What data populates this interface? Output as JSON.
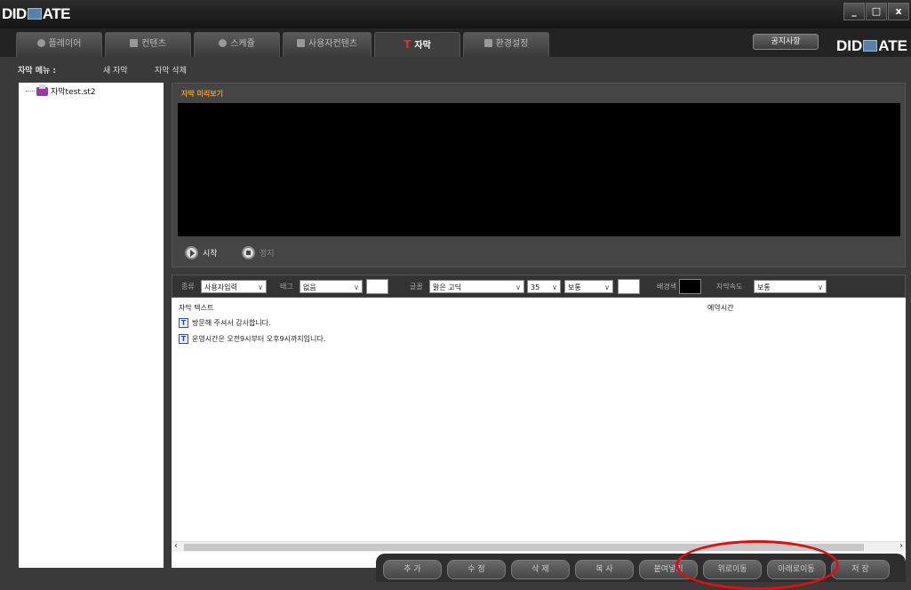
{
  "window": {
    "logo_left": "DID",
    "logo_right": "ATE",
    "controls": [
      "_",
      "□",
      "x"
    ]
  },
  "tabs": [
    {
      "label": "플레이어",
      "icon": "play-circle-icon",
      "active": false
    },
    {
      "label": "컨텐츠",
      "icon": "film-icon",
      "active": false
    },
    {
      "label": "스케쥴",
      "icon": "clock-icon",
      "active": false
    },
    {
      "label": "사용자컨텐츠",
      "icon": "user-content-icon",
      "active": false
    },
    {
      "label": "자막",
      "icon": "subtitle-t-icon",
      "active": true
    },
    {
      "label": "환경설정",
      "icon": "settings-icon",
      "active": false
    }
  ],
  "header": {
    "notice_label": "공지사항",
    "logo_left": "DID",
    "logo_right": "ATE"
  },
  "menu": {
    "title": "자막 메뉴 :",
    "new_subtitle": "새 자막",
    "delete_subtitle": "자막 삭제"
  },
  "tree": {
    "items": [
      {
        "label": "자막test.st2"
      }
    ]
  },
  "preview": {
    "title": "자막 미리보기",
    "start_label": "시작",
    "stop_label": "정지"
  },
  "options": {
    "type_label": "종류",
    "type_value": "사용자입력",
    "tag_label": "태그",
    "tag_value": "없음",
    "font_label": "글꼴",
    "font_value": "맑은 고딕",
    "size_value": "35",
    "weight_value": "보통",
    "bg_label": "배경색",
    "speed_label": "자막속도",
    "speed_value": "보통",
    "text_color": "#ffffff",
    "bg_color": "#000000"
  },
  "table": {
    "col_text": "자막 텍스트",
    "col_time": "예약시간",
    "rows": [
      {
        "text": "방문해 주셔서 감사합니다.",
        "time": ""
      },
      {
        "text": "운영시간은 오전9시부터 오후9시까지입니다.",
        "time": ""
      }
    ]
  },
  "buttons": {
    "add": "추 가",
    "edit": "수 정",
    "delete": "삭 제",
    "copy": "복 사",
    "paste": "붙여넣기",
    "move_up": "위로이동",
    "move_down": "아래로이동",
    "save": "저 장"
  },
  "colors": {
    "preview_title": "#f0a020",
    "highlight_oval": "#e01010",
    "active_tab_icon": "#e03030"
  }
}
